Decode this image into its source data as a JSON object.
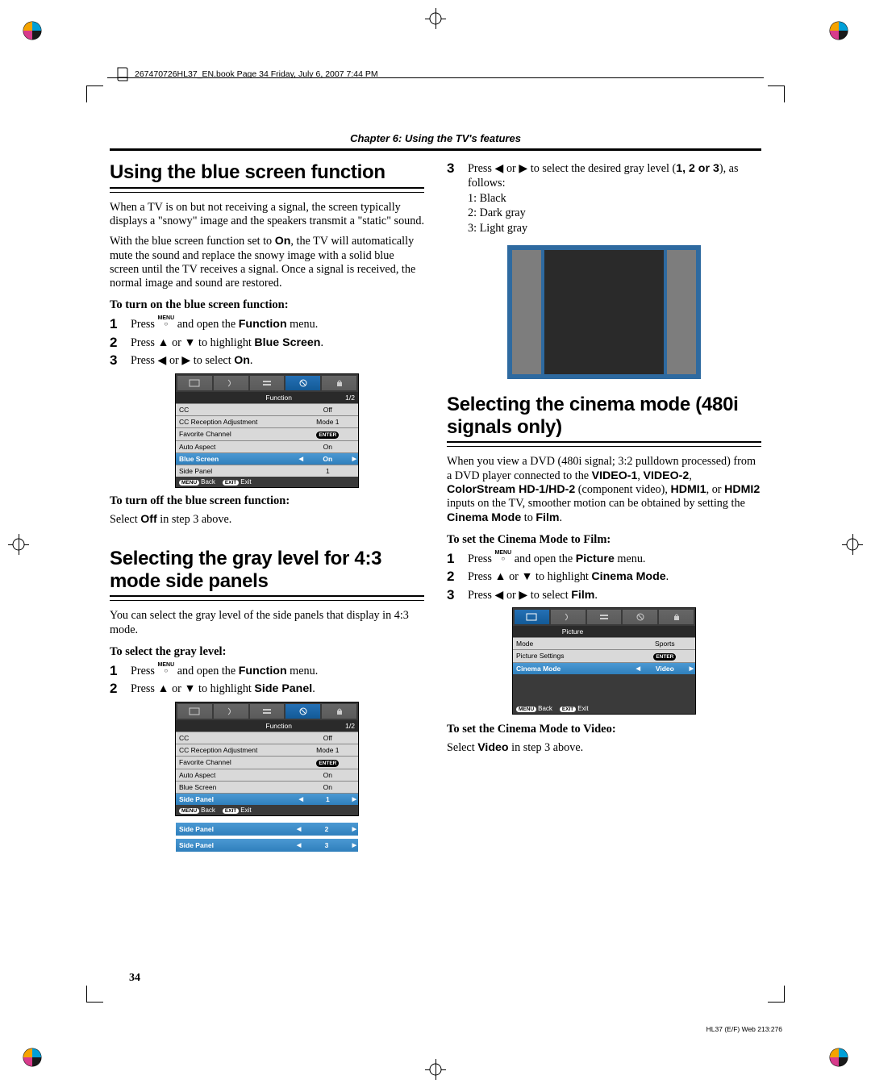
{
  "book_ref": "267470726HL37_EN.book  Page 34  Friday, July 6, 2007  7:44 PM",
  "chapter_header": "Chapter 6: Using the TV's features",
  "page_number": "34",
  "footer_code": "HL37 (E/F) Web 213:276",
  "sec_blue": {
    "title": "Using the blue screen function",
    "p1": "When a TV is on but not receiving a signal, the screen typically displays a \"snowy\" image and the speakers transmit a \"static\" sound.",
    "p2_a": "With the blue screen function set to ",
    "p2_on": "On",
    "p2_b": ", the TV will automatically mute the sound and replace the snowy image with a solid blue screen until the TV receives a signal. Once a signal is received, the normal image and sound are restored.",
    "sub_on": "To turn on the blue screen function:",
    "step1_a": "Press ",
    "step1_b": " and open the ",
    "step1_fn": "Function",
    "step1_c": " menu.",
    "step2_a": "Press ▲ or ▼ to highlight ",
    "step2_bs": "Blue Screen",
    "step2_b": ".",
    "step3_a": "Press ◀ or ▶ to select ",
    "step3_on": "On",
    "step3_b": ".",
    "sub_off": "To turn off the blue screen function:",
    "off_a": "Select ",
    "off_off": "Off",
    "off_b": " in step 3 above."
  },
  "menu_function": {
    "category": "Function",
    "page": "1/2",
    "rows": [
      {
        "lbl": "CC",
        "val": "Off"
      },
      {
        "lbl": "CC Reception Adjustment",
        "val": "Mode 1"
      },
      {
        "lbl": "Favorite Channel",
        "enter": true
      },
      {
        "lbl": "Auto Aspect",
        "val": "On"
      },
      {
        "lbl": "Blue Screen",
        "val": "On",
        "sel": true
      },
      {
        "lbl": "Side Panel",
        "val": "1"
      }
    ],
    "footer_back": "Back",
    "footer_exit": "Exit",
    "menu_key": "MENU",
    "exit_key": "EXIT"
  },
  "sec_gray": {
    "title": "Selecting the gray level for 4:3 mode side panels",
    "p1": "You can select the gray level of the side panels that display in 4:3 mode.",
    "sub": "To select the gray level:",
    "step1_a": "Press ",
    "step1_b": " and open the ",
    "step1_fn": "Function",
    "step1_c": " menu.",
    "step2_a": "Press ▲ or ▼ to highlight ",
    "step2_sp": "Side Panel",
    "step2_b": "."
  },
  "menu_side": {
    "category": "Function",
    "page": "1/2",
    "rows": [
      {
        "lbl": "CC",
        "val": "Off"
      },
      {
        "lbl": "CC Reception Adjustment",
        "val": "Mode 1"
      },
      {
        "lbl": "Favorite Channel",
        "enter": true
      },
      {
        "lbl": "Auto Aspect",
        "val": "On"
      },
      {
        "lbl": "Blue Screen",
        "val": "On"
      },
      {
        "lbl": "Side Panel",
        "val": "1",
        "sel": true
      }
    ],
    "extras": [
      {
        "lbl": "Side Panel",
        "val": "2"
      },
      {
        "lbl": "Side Panel",
        "val": "3"
      }
    ]
  },
  "sec_gray_right": {
    "step3_a": "Press ◀ or ▶ to select the desired gray level (",
    "step3_vals": "1, 2 or 3",
    "step3_b": "), as follows:",
    "levels": [
      "1: Black",
      "2: Dark gray",
      "3: Light gray"
    ]
  },
  "sec_cinema": {
    "title": "Selecting the cinema mode (480i signals only)",
    "p1_a": "When you view a DVD (480i signal; 3:2 pulldown processed) from a DVD player connected to the ",
    "p1_v1": "VIDEO-1",
    "p1_sep": ", ",
    "p1_v2": "VIDEO-2",
    "p1_cs": "ColorStream HD-1/HD-2",
    "p1_cs_suffix": " (component video), ",
    "p1_h1": "HDMI1",
    "p1_or": ", or ",
    "p1_h2": "HDMI2",
    "p1_mid": " inputs on the TV, smoother motion can be obtained by setting the ",
    "p1_cm": "Cinema Mode",
    "p1_to": " to ",
    "p1_film": "Film",
    "p1_end": ".",
    "sub_film": "To set the Cinema Mode to Film:",
    "step1_a": "Press ",
    "step1_b": " and open the ",
    "step1_pic": "Picture",
    "step1_c": " menu.",
    "step2_a": "Press ▲ or ▼ to highlight ",
    "step2_cm": "Cinema Mode",
    "step2_b": ".",
    "step3_a": "Press ◀ or ▶ to select ",
    "step3_film": "Film",
    "step3_b": ".",
    "sub_video": "To set the Cinema Mode to Video:",
    "video_a": "Select ",
    "video_v": "Video",
    "video_b": " in step 3 above."
  },
  "menu_picture": {
    "category": "Picture",
    "rows": [
      {
        "lbl": "Mode",
        "val": "Sports"
      },
      {
        "lbl": "Picture Settings",
        "enter": true
      },
      {
        "lbl": "Cinema Mode",
        "val": "Video",
        "sel": true
      }
    ]
  },
  "enter_label": "ENTER",
  "step_nums": {
    "1": "1",
    "2": "2",
    "3": "3"
  },
  "menu_word": "MENU"
}
